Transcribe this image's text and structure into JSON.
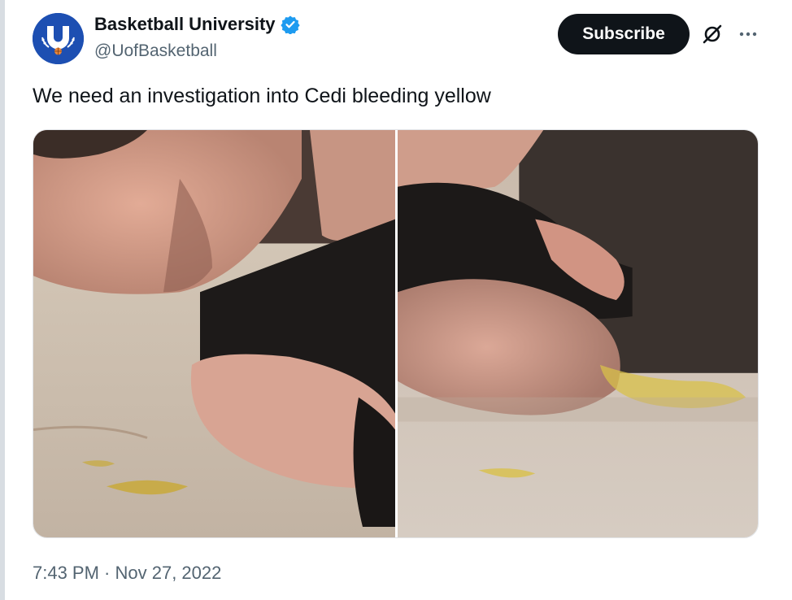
{
  "account": {
    "display_name": "Basketball University",
    "handle": "@UofBasketball",
    "verified": true,
    "avatar_icon": "basketball-university-logo",
    "avatar_color": "#1d4fb2"
  },
  "actions": {
    "subscribe_label": "Subscribe",
    "grok_icon": "grok-icon",
    "more_icon": "more-icon"
  },
  "tweet": {
    "text": "We need an investigation into Cedi bleeding yellow",
    "timestamp": "7:43 PM · Nov 27, 2022"
  },
  "media": {
    "photo_count": 2
  },
  "colors": {
    "text_primary": "#0f1419",
    "text_secondary": "#536471",
    "verified_blue": "#1d9bf0",
    "button_bg": "#0f1419"
  }
}
